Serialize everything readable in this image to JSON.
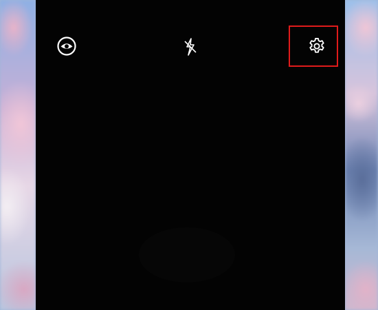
{
  "camera": {
    "toolbar": {
      "lens_icon": "lens-eye-icon",
      "flash_icon": "flash-off-icon",
      "settings_icon": "gear-icon"
    },
    "highlight_color": "#e11b1b",
    "viewfinder_color": "#030303"
  }
}
